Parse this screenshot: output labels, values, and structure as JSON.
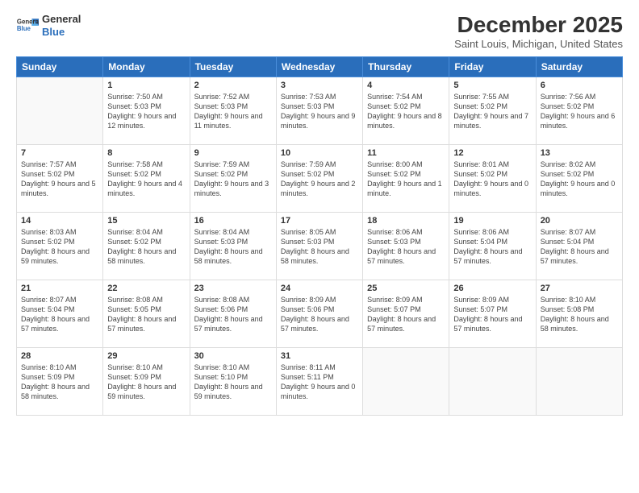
{
  "header": {
    "logo_line1": "General",
    "logo_line2": "Blue",
    "month": "December 2025",
    "location": "Saint Louis, Michigan, United States"
  },
  "weekdays": [
    "Sunday",
    "Monday",
    "Tuesday",
    "Wednesday",
    "Thursday",
    "Friday",
    "Saturday"
  ],
  "weeks": [
    [
      {
        "day": "",
        "sunrise": "",
        "sunset": "",
        "daylight": ""
      },
      {
        "day": "1",
        "sunrise": "Sunrise: 7:50 AM",
        "sunset": "Sunset: 5:03 PM",
        "daylight": "Daylight: 9 hours and 12 minutes."
      },
      {
        "day": "2",
        "sunrise": "Sunrise: 7:52 AM",
        "sunset": "Sunset: 5:03 PM",
        "daylight": "Daylight: 9 hours and 11 minutes."
      },
      {
        "day": "3",
        "sunrise": "Sunrise: 7:53 AM",
        "sunset": "Sunset: 5:03 PM",
        "daylight": "Daylight: 9 hours and 9 minutes."
      },
      {
        "day": "4",
        "sunrise": "Sunrise: 7:54 AM",
        "sunset": "Sunset: 5:02 PM",
        "daylight": "Daylight: 9 hours and 8 minutes."
      },
      {
        "day": "5",
        "sunrise": "Sunrise: 7:55 AM",
        "sunset": "Sunset: 5:02 PM",
        "daylight": "Daylight: 9 hours and 7 minutes."
      },
      {
        "day": "6",
        "sunrise": "Sunrise: 7:56 AM",
        "sunset": "Sunset: 5:02 PM",
        "daylight": "Daylight: 9 hours and 6 minutes."
      }
    ],
    [
      {
        "day": "7",
        "sunrise": "Sunrise: 7:57 AM",
        "sunset": "Sunset: 5:02 PM",
        "daylight": "Daylight: 9 hours and 5 minutes."
      },
      {
        "day": "8",
        "sunrise": "Sunrise: 7:58 AM",
        "sunset": "Sunset: 5:02 PM",
        "daylight": "Daylight: 9 hours and 4 minutes."
      },
      {
        "day": "9",
        "sunrise": "Sunrise: 7:59 AM",
        "sunset": "Sunset: 5:02 PM",
        "daylight": "Daylight: 9 hours and 3 minutes."
      },
      {
        "day": "10",
        "sunrise": "Sunrise: 7:59 AM",
        "sunset": "Sunset: 5:02 PM",
        "daylight": "Daylight: 9 hours and 2 minutes."
      },
      {
        "day": "11",
        "sunrise": "Sunrise: 8:00 AM",
        "sunset": "Sunset: 5:02 PM",
        "daylight": "Daylight: 9 hours and 1 minute."
      },
      {
        "day": "12",
        "sunrise": "Sunrise: 8:01 AM",
        "sunset": "Sunset: 5:02 PM",
        "daylight": "Daylight: 9 hours and 0 minutes."
      },
      {
        "day": "13",
        "sunrise": "Sunrise: 8:02 AM",
        "sunset": "Sunset: 5:02 PM",
        "daylight": "Daylight: 9 hours and 0 minutes."
      }
    ],
    [
      {
        "day": "14",
        "sunrise": "Sunrise: 8:03 AM",
        "sunset": "Sunset: 5:02 PM",
        "daylight": "Daylight: 8 hours and 59 minutes."
      },
      {
        "day": "15",
        "sunrise": "Sunrise: 8:04 AM",
        "sunset": "Sunset: 5:02 PM",
        "daylight": "Daylight: 8 hours and 58 minutes."
      },
      {
        "day": "16",
        "sunrise": "Sunrise: 8:04 AM",
        "sunset": "Sunset: 5:03 PM",
        "daylight": "Daylight: 8 hours and 58 minutes."
      },
      {
        "day": "17",
        "sunrise": "Sunrise: 8:05 AM",
        "sunset": "Sunset: 5:03 PM",
        "daylight": "Daylight: 8 hours and 58 minutes."
      },
      {
        "day": "18",
        "sunrise": "Sunrise: 8:06 AM",
        "sunset": "Sunset: 5:03 PM",
        "daylight": "Daylight: 8 hours and 57 minutes."
      },
      {
        "day": "19",
        "sunrise": "Sunrise: 8:06 AM",
        "sunset": "Sunset: 5:04 PM",
        "daylight": "Daylight: 8 hours and 57 minutes."
      },
      {
        "day": "20",
        "sunrise": "Sunrise: 8:07 AM",
        "sunset": "Sunset: 5:04 PM",
        "daylight": "Daylight: 8 hours and 57 minutes."
      }
    ],
    [
      {
        "day": "21",
        "sunrise": "Sunrise: 8:07 AM",
        "sunset": "Sunset: 5:04 PM",
        "daylight": "Daylight: 8 hours and 57 minutes."
      },
      {
        "day": "22",
        "sunrise": "Sunrise: 8:08 AM",
        "sunset": "Sunset: 5:05 PM",
        "daylight": "Daylight: 8 hours and 57 minutes."
      },
      {
        "day": "23",
        "sunrise": "Sunrise: 8:08 AM",
        "sunset": "Sunset: 5:06 PM",
        "daylight": "Daylight: 8 hours and 57 minutes."
      },
      {
        "day": "24",
        "sunrise": "Sunrise: 8:09 AM",
        "sunset": "Sunset: 5:06 PM",
        "daylight": "Daylight: 8 hours and 57 minutes."
      },
      {
        "day": "25",
        "sunrise": "Sunrise: 8:09 AM",
        "sunset": "Sunset: 5:07 PM",
        "daylight": "Daylight: 8 hours and 57 minutes."
      },
      {
        "day": "26",
        "sunrise": "Sunrise: 8:09 AM",
        "sunset": "Sunset: 5:07 PM",
        "daylight": "Daylight: 8 hours and 57 minutes."
      },
      {
        "day": "27",
        "sunrise": "Sunrise: 8:10 AM",
        "sunset": "Sunset: 5:08 PM",
        "daylight": "Daylight: 8 hours and 58 minutes."
      }
    ],
    [
      {
        "day": "28",
        "sunrise": "Sunrise: 8:10 AM",
        "sunset": "Sunset: 5:09 PM",
        "daylight": "Daylight: 8 hours and 58 minutes."
      },
      {
        "day": "29",
        "sunrise": "Sunrise: 8:10 AM",
        "sunset": "Sunset: 5:09 PM",
        "daylight": "Daylight: 8 hours and 59 minutes."
      },
      {
        "day": "30",
        "sunrise": "Sunrise: 8:10 AM",
        "sunset": "Sunset: 5:10 PM",
        "daylight": "Daylight: 8 hours and 59 minutes."
      },
      {
        "day": "31",
        "sunrise": "Sunrise: 8:11 AM",
        "sunset": "Sunset: 5:11 PM",
        "daylight": "Daylight: 9 hours and 0 minutes."
      },
      {
        "day": "",
        "sunrise": "",
        "sunset": "",
        "daylight": ""
      },
      {
        "day": "",
        "sunrise": "",
        "sunset": "",
        "daylight": ""
      },
      {
        "day": "",
        "sunrise": "",
        "sunset": "",
        "daylight": ""
      }
    ]
  ]
}
